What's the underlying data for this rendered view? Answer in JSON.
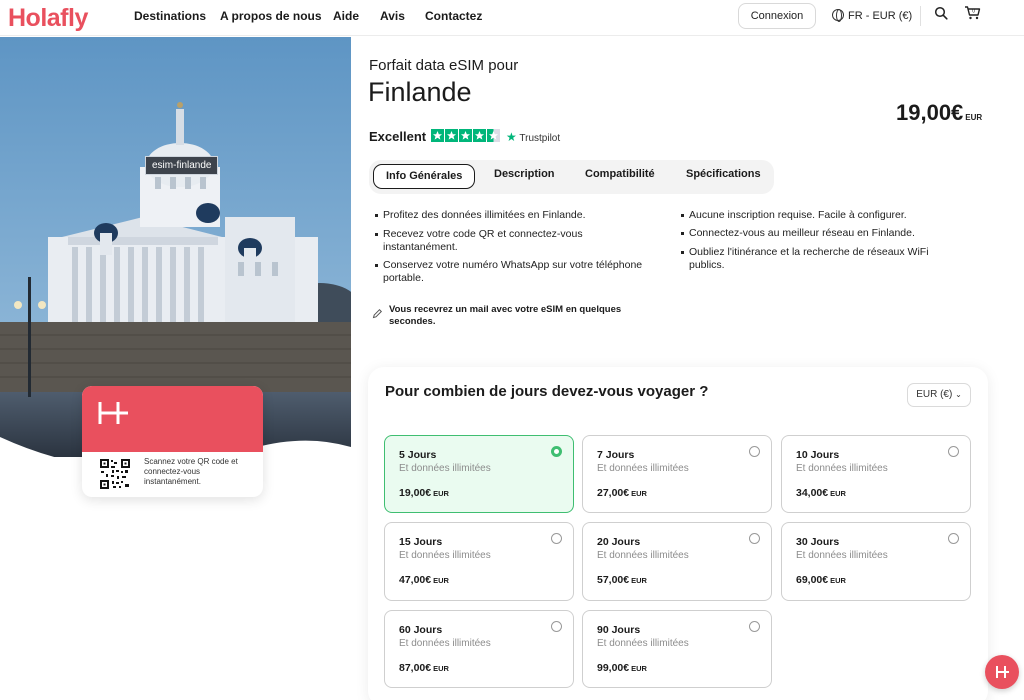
{
  "header": {
    "logo": "Holafly",
    "nav": [
      "Destinations",
      "A propos de nous",
      "Aide",
      "Avis",
      "Contactez"
    ],
    "login_label": "Connexion",
    "lang_label": "FR - EUR (€)",
    "icons": [
      "globe-icon",
      "search-icon",
      "cart-icon"
    ]
  },
  "hero": {
    "tag": "esim-finlande",
    "qr_text": "Scannez votre QR code et connectez-vous instantanément."
  },
  "product": {
    "subtitle": "Forfait data eSIM pour",
    "title": "Finlande",
    "price": "19,00€",
    "price_currency": "EUR",
    "rating_label": "Excellent",
    "rating_stars": 4.5,
    "trustpilot": "Trustpilot"
  },
  "tabs": [
    "Info Générales",
    "Description",
    "Compatibilité",
    "Spécifications"
  ],
  "features_left": [
    "Profitez des données illimitées en Finlande.",
    "Recevez votre code QR et connectez-vous instantanément.",
    "Conservez votre numéro WhatsApp sur votre téléphone portable."
  ],
  "features_right": [
    "Aucune inscription requise. Facile à configurer.",
    "Connectez-vous au meilleur réseau en Finlande.",
    "Oubliez l'itinérance et la recherche de réseaux WiFi publics."
  ],
  "notice": "Vous recevrez un mail avec votre eSIM en quelques secondes.",
  "plans_section": {
    "title": "Pour combien de jours devez-vous voyager ?",
    "currency_select": "EUR (€)",
    "plans": [
      {
        "name": "5 Jours",
        "desc": "Et données illimitées",
        "price": "19,00€",
        "cur": "EUR",
        "selected": true
      },
      {
        "name": "7 Jours",
        "desc": "Et données illimitées",
        "price": "27,00€",
        "cur": "EUR",
        "selected": false
      },
      {
        "name": "10 Jours",
        "desc": "Et données illimitées",
        "price": "34,00€",
        "cur": "EUR",
        "selected": false
      },
      {
        "name": "15 Jours",
        "desc": "Et données illimitées",
        "price": "47,00€",
        "cur": "EUR",
        "selected": false
      },
      {
        "name": "20 Jours",
        "desc": "Et données illimitées",
        "price": "57,00€",
        "cur": "EUR",
        "selected": false
      },
      {
        "name": "30 Jours",
        "desc": "Et données illimitées",
        "price": "69,00€",
        "cur": "EUR",
        "selected": false
      },
      {
        "name": "60 Jours",
        "desc": "Et données illimitées",
        "price": "87,00€",
        "cur": "EUR",
        "selected": false
      },
      {
        "name": "90 Jours",
        "desc": "Et données illimitées",
        "price": "99,00€",
        "cur": "EUR",
        "selected": false
      }
    ]
  },
  "colors": {
    "brand": "#e9505e",
    "selected": "#3fbe71",
    "trustpilot": "#00b67a"
  }
}
